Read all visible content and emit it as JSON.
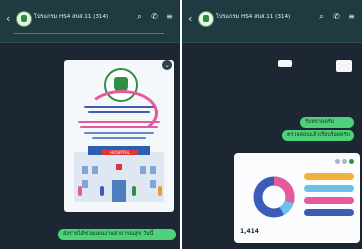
{
  "chat": {
    "title": "โปรแกรม HS4 สบส.11 (314)",
    "member_count_glyph": "🔇"
  },
  "phone1": {
    "bottom_bubble": "ส่งรายได้ช่วยแผนงานสาธารณสุข วันนี้"
  },
  "phone2": {
    "top_label": "ok",
    "bubble_a": "รับทราบครับ",
    "bubble_b": "ตรวจสอบแล้วเรียบร้อยครับ",
    "stat_value": "1,414"
  },
  "colors": {
    "bg_dark": "#1c2733",
    "bubble_green": "#4fd07a",
    "accent_pink": "#e45a9b",
    "accent_blue": "#3b5db8"
  }
}
